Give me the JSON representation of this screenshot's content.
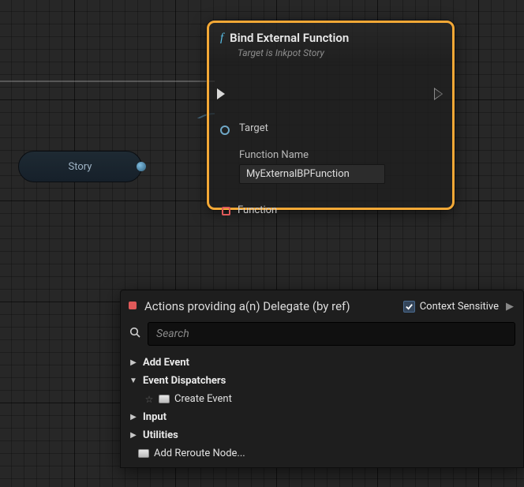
{
  "storyNode": {
    "label": "Story"
  },
  "fnNode": {
    "title": "Bind External Function",
    "subtitle": "Target is Inkpot Story",
    "targetLabel": "Target",
    "fnameLabel": "Function Name",
    "fnameValue": "MyExternalBPFunction",
    "delegateLabel": "Function"
  },
  "menu": {
    "title": "Actions providing a(n) Delegate (by ref)",
    "contextLabel": "Context Sensitive",
    "contextChecked": true,
    "searchPlaceholder": "Search",
    "items": [
      {
        "kind": "cat",
        "expanded": false,
        "label": "Add Event",
        "indent": 0
      },
      {
        "kind": "cat",
        "expanded": true,
        "label": "Event Dispatchers",
        "indent": 0
      },
      {
        "kind": "leaf",
        "label": "Create Event",
        "indent": 2,
        "star": true
      },
      {
        "kind": "cat",
        "expanded": false,
        "label": "Input",
        "indent": 0
      },
      {
        "kind": "cat",
        "expanded": false,
        "label": "Utilities",
        "indent": 0
      },
      {
        "kind": "leaf",
        "label": "Add Reroute Node...",
        "indent": 1,
        "star": false
      }
    ]
  }
}
